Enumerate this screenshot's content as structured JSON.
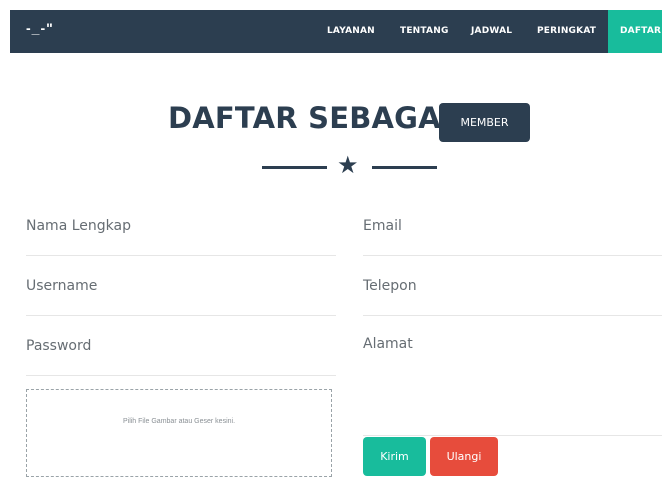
{
  "navbar": {
    "brand": "-_-\"",
    "items": [
      {
        "label": "LAYANAN"
      },
      {
        "label": "TENTANG"
      },
      {
        "label": "JADWAL"
      },
      {
        "label": "PERINGKAT"
      },
      {
        "label": "DAFTAR",
        "active": true
      }
    ]
  },
  "header": {
    "title": "DAFTAR SEBAGAI",
    "role_button": "MEMBER",
    "divider_icon": "star-icon"
  },
  "form": {
    "left_fields": {
      "full_name": "Nama Lengkap",
      "username": "Username",
      "password": "Password"
    },
    "right_fields": {
      "email": "Email",
      "phone": "Telepon",
      "address": "Alamat"
    },
    "dropzone_text": "Pilih File Gambar atau Geser kesini.",
    "submit_label": "Kirim",
    "reset_label": "Ulangi"
  },
  "colors": {
    "navbar": "#2c3e50",
    "accent_green": "#18bc9c",
    "danger_red": "#e74c3c",
    "text_dark": "#2c3e50"
  }
}
